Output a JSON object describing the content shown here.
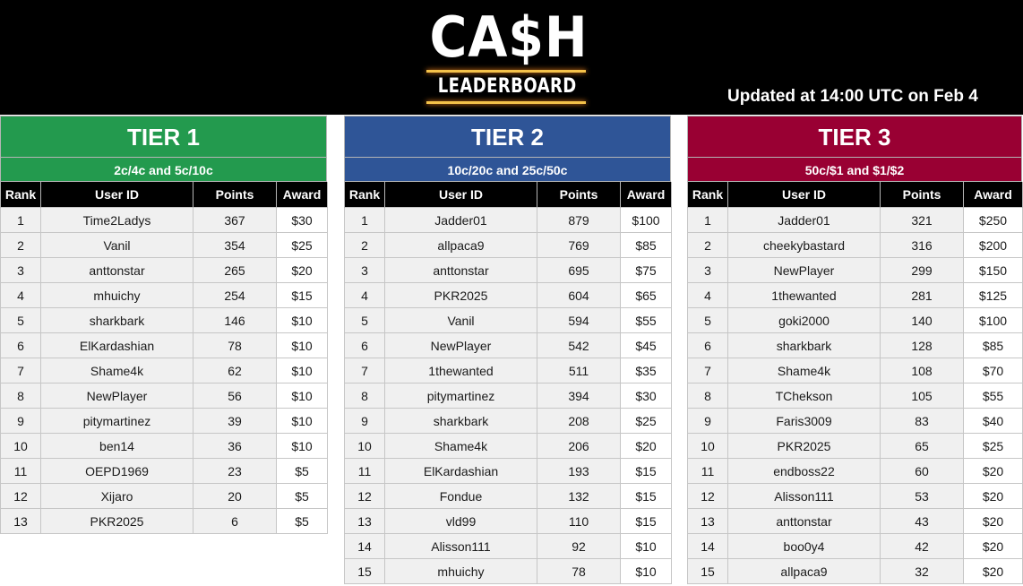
{
  "header": {
    "logo_top": "CA$H",
    "logo_bottom": "LEADERBOARD",
    "updated": "Updated at 14:00 UTC on Feb 4"
  },
  "columns": [
    "Rank",
    "User ID",
    "Points",
    "Award"
  ],
  "tiers": [
    {
      "title": "TIER 1",
      "stakes": "2c/4c and 5c/10c",
      "color": "#239a4e",
      "rows": [
        [
          "1",
          "Time2Ladys",
          "367",
          "$30"
        ],
        [
          "2",
          "Vanil",
          "354",
          "$25"
        ],
        [
          "3",
          "anttonstar",
          "265",
          "$20"
        ],
        [
          "4",
          "mhuichy",
          "254",
          "$15"
        ],
        [
          "5",
          "sharkbark",
          "146",
          "$10"
        ],
        [
          "6",
          "ElKardashian",
          "78",
          "$10"
        ],
        [
          "7",
          "Shame4k",
          "62",
          "$10"
        ],
        [
          "8",
          "NewPlayer",
          "56",
          "$10"
        ],
        [
          "9",
          "pitymartinez",
          "39",
          "$10"
        ],
        [
          "10",
          "ben14",
          "36",
          "$10"
        ],
        [
          "11",
          "OEPD1969",
          "23",
          "$5"
        ],
        [
          "12",
          "Xijaro",
          "20",
          "$5"
        ],
        [
          "13",
          "PKR2025",
          "6",
          "$5"
        ]
      ]
    },
    {
      "title": "TIER 2",
      "stakes": "10c/20c and 25c/50c",
      "color": "#2f5597",
      "rows": [
        [
          "1",
          "Jadder01",
          "879",
          "$100"
        ],
        [
          "2",
          "allpaca9",
          "769",
          "$85"
        ],
        [
          "3",
          "anttonstar",
          "695",
          "$75"
        ],
        [
          "4",
          "PKR2025",
          "604",
          "$65"
        ],
        [
          "5",
          "Vanil",
          "594",
          "$55"
        ],
        [
          "6",
          "NewPlayer",
          "542",
          "$45"
        ],
        [
          "7",
          "1thewanted",
          "511",
          "$35"
        ],
        [
          "8",
          "pitymartinez",
          "394",
          "$30"
        ],
        [
          "9",
          "sharkbark",
          "208",
          "$25"
        ],
        [
          "10",
          "Shame4k",
          "206",
          "$20"
        ],
        [
          "11",
          "ElKardashian",
          "193",
          "$15"
        ],
        [
          "12",
          "Fondue",
          "132",
          "$15"
        ],
        [
          "13",
          "vld99",
          "110",
          "$15"
        ],
        [
          "14",
          "Alisson111",
          "92",
          "$10"
        ],
        [
          "15",
          "mhuichy",
          "78",
          "$10"
        ]
      ]
    },
    {
      "title": "TIER 3",
      "stakes": "50c/$1 and $1/$2",
      "color": "#990033",
      "rows": [
        [
          "1",
          "Jadder01",
          "321",
          "$250"
        ],
        [
          "2",
          "cheekybastard",
          "316",
          "$200"
        ],
        [
          "3",
          "NewPlayer",
          "299",
          "$150"
        ],
        [
          "4",
          "1thewanted",
          "281",
          "$125"
        ],
        [
          "5",
          "goki2000",
          "140",
          "$100"
        ],
        [
          "6",
          "sharkbark",
          "128",
          "$85"
        ],
        [
          "7",
          "Shame4k",
          "108",
          "$70"
        ],
        [
          "8",
          "TChekson",
          "105",
          "$55"
        ],
        [
          "9",
          "Faris3009",
          "83",
          "$40"
        ],
        [
          "10",
          "PKR2025",
          "65",
          "$25"
        ],
        [
          "11",
          "endboss22",
          "60",
          "$20"
        ],
        [
          "12",
          "Alisson111",
          "53",
          "$20"
        ],
        [
          "13",
          "anttonstar",
          "43",
          "$20"
        ],
        [
          "14",
          "boo0y4",
          "42",
          "$20"
        ],
        [
          "15",
          "allpaca9",
          "32",
          "$20"
        ]
      ]
    }
  ]
}
